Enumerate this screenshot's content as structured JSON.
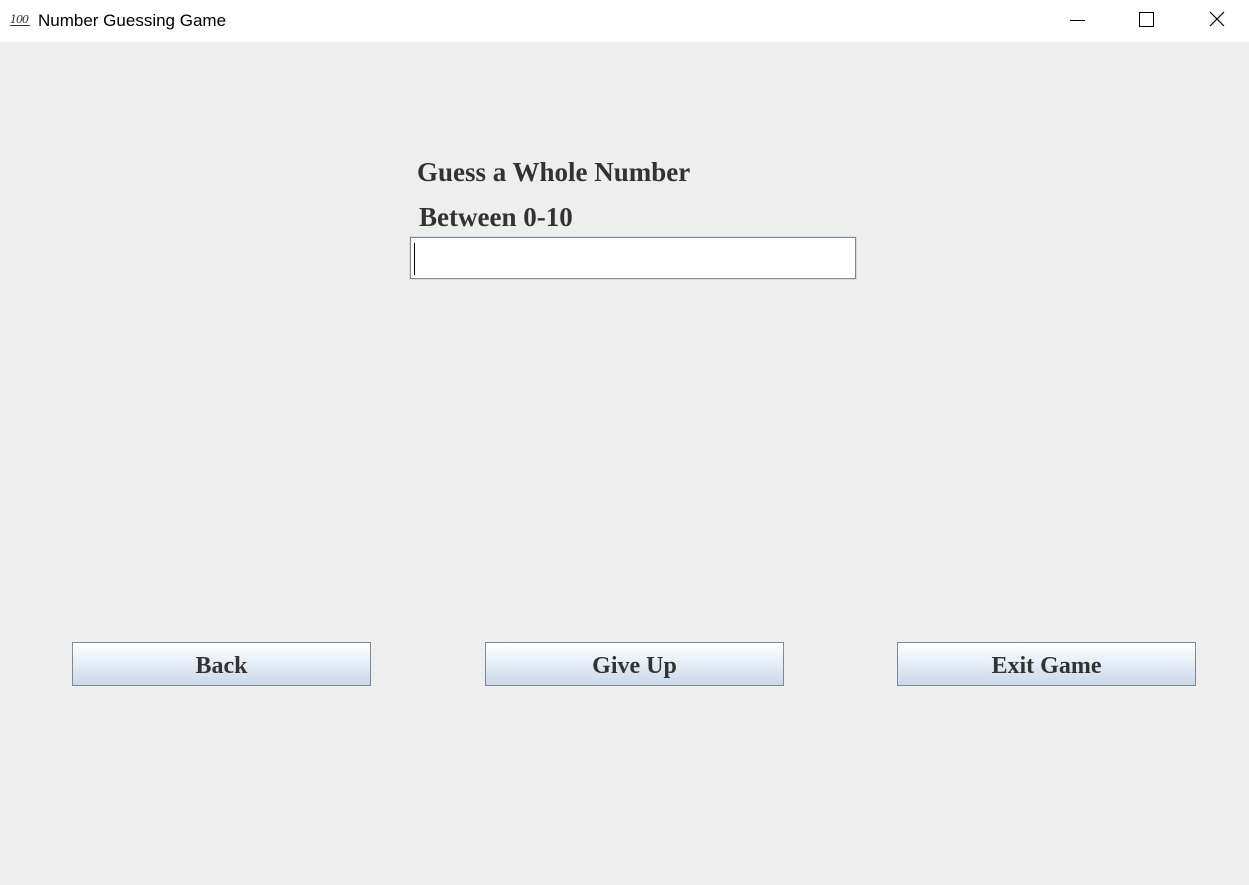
{
  "window": {
    "title": "Number Guessing Game",
    "icon": "hundred-points-icon",
    "icon_text": "100",
    "controls": [
      "minimize-icon",
      "maximize-icon",
      "close-icon"
    ]
  },
  "prompt": {
    "line1": "Guess a Whole Number",
    "line2": "Between 0-10"
  },
  "guess_input": {
    "value": ""
  },
  "buttons": {
    "back": "Back",
    "give_up": "Give Up",
    "exit": "Exit Game"
  },
  "colors": {
    "background": "#eeeeee",
    "text": "#333333",
    "button_border": "#7a8a99"
  }
}
